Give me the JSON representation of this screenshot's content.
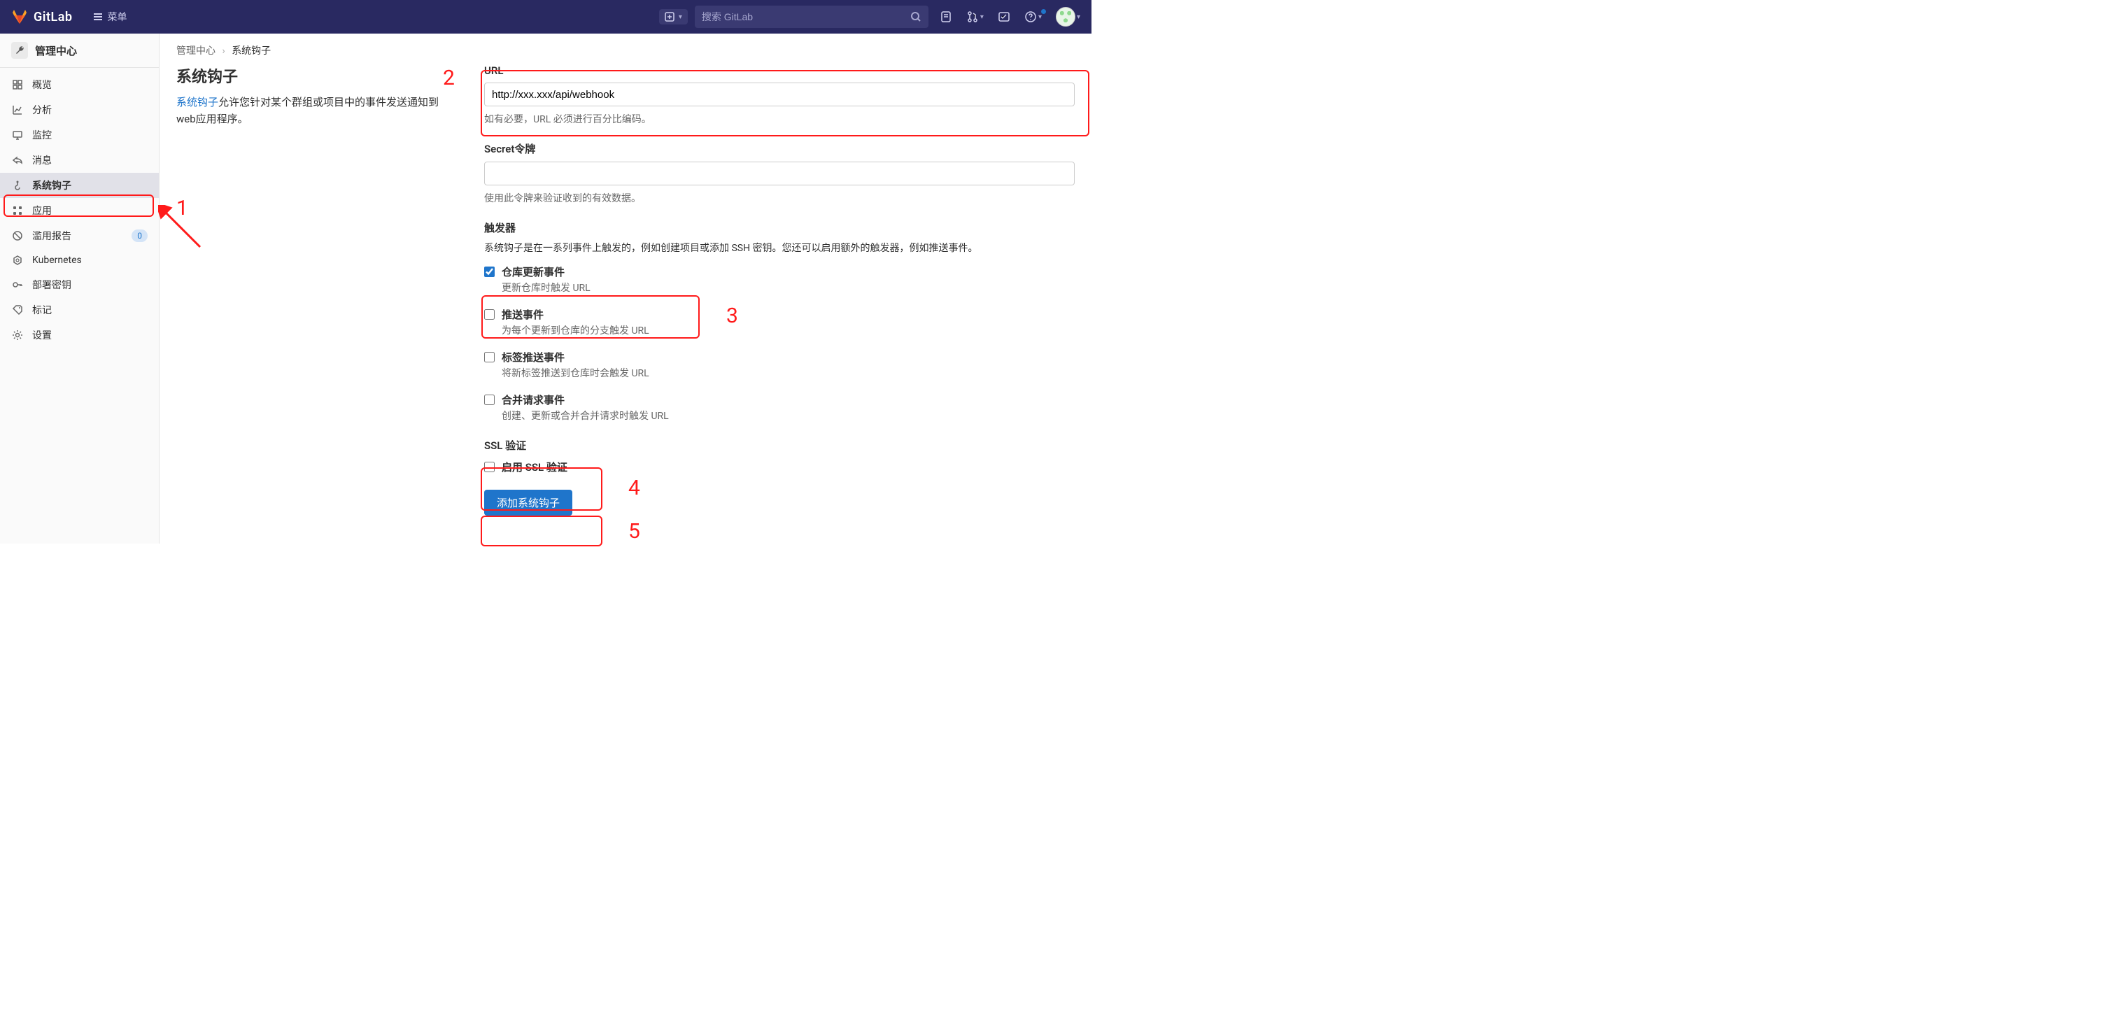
{
  "header": {
    "brand": "GitLab",
    "menu_label": "菜单",
    "search_placeholder": "搜索 GitLab"
  },
  "sidebar": {
    "title": "管理中心",
    "items": [
      {
        "label": "概览",
        "icon": "overview"
      },
      {
        "label": "分析",
        "icon": "analytics"
      },
      {
        "label": "监控",
        "icon": "monitor"
      },
      {
        "label": "消息",
        "icon": "messages"
      },
      {
        "label": "系统钩子",
        "icon": "hooks",
        "active": true
      },
      {
        "label": "应用",
        "icon": "apps"
      },
      {
        "label": "滥用报告",
        "icon": "abuse",
        "badge": "0"
      },
      {
        "label": "Kubernetes",
        "icon": "kubernetes"
      },
      {
        "label": "部署密钥",
        "icon": "deploykeys"
      },
      {
        "label": "标记",
        "icon": "labels"
      },
      {
        "label": "设置",
        "icon": "settings"
      }
    ]
  },
  "breadcrumbs": {
    "root": "管理中心",
    "current": "系统钩子"
  },
  "intro": {
    "heading": "系统钩子",
    "link_text": "系统钩子",
    "body_after_link": "允许您针对某个群组或项目中的事件发送通知到web应用程序。"
  },
  "form": {
    "url": {
      "label": "URL",
      "value": "http://xxx.xxx/api/webhook",
      "help": "如有必要，URL 必须进行百分比编码。"
    },
    "secret": {
      "label": "Secret令牌",
      "value": "",
      "help": "使用此令牌来验证收到的有效数据。"
    },
    "triggers": {
      "label": "触发器",
      "help": "系统钩子是在一系列事件上触发的，例如创建项目或添加 SSH 密钥。您还可以启用额外的触发器，例如推送事件。",
      "options": [
        {
          "label": "仓库更新事件",
          "checked": true,
          "sub": "更新仓库时触发 URL"
        },
        {
          "label": "推送事件",
          "checked": false,
          "sub": "为每个更新到仓库的分支触发 URL"
        },
        {
          "label": "标签推送事件",
          "checked": false,
          "sub": "将新标签推送到仓库时会触发 URL"
        },
        {
          "label": "合并请求事件",
          "checked": false,
          "sub": "创建、更新或合并合并请求时触发 URL"
        }
      ]
    },
    "ssl": {
      "label": "SSL 验证",
      "checkbox_label": "启用 SSL 验证",
      "checked": false
    },
    "submit": "添加系统钩子"
  },
  "annotations": {
    "n1": "1",
    "n2": "2",
    "n3": "3",
    "n4": "4",
    "n5": "5"
  }
}
